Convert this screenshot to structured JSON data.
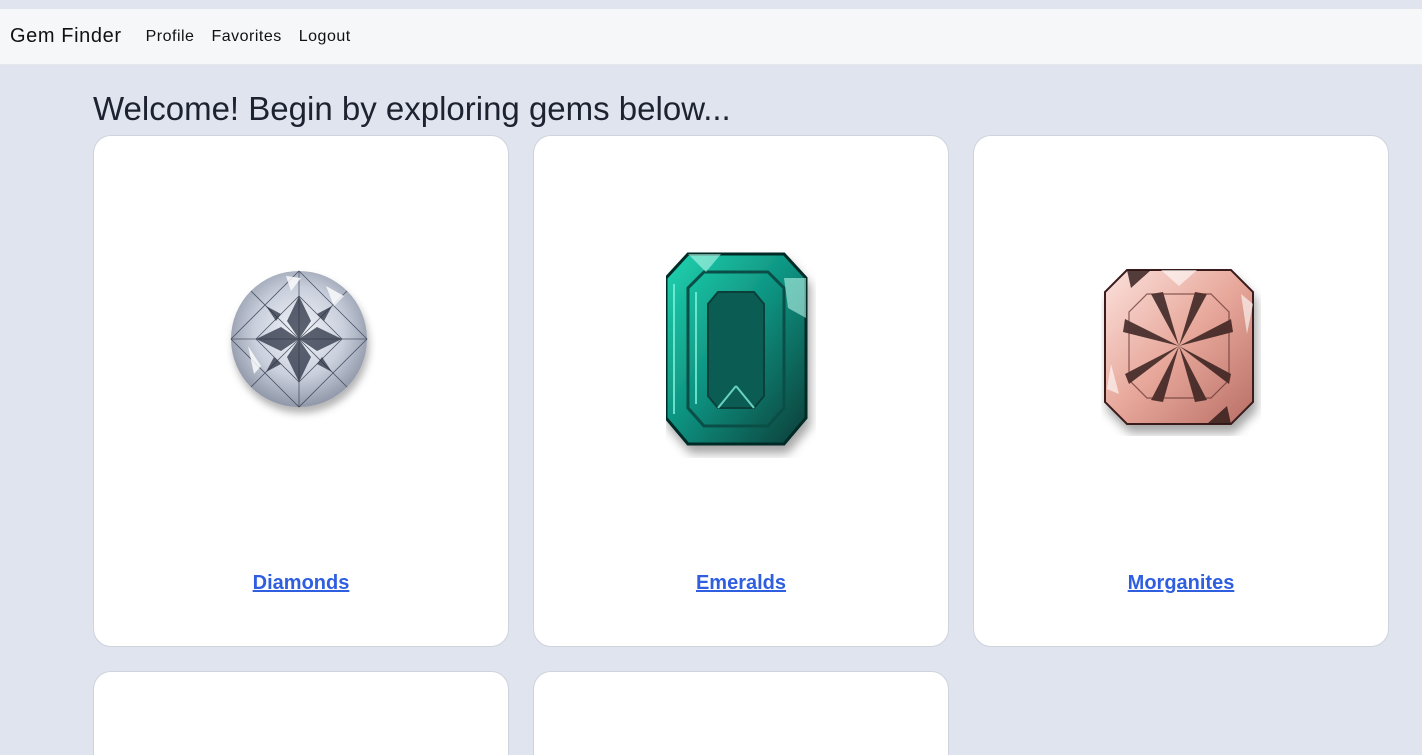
{
  "nav": {
    "brand": "Gem Finder",
    "links": [
      "Profile",
      "Favorites",
      "Logout"
    ]
  },
  "main": {
    "heading": "Welcome! Begin by exploring gems below...",
    "gems": [
      {
        "label": "Diamonds",
        "image": "diamond-image"
      },
      {
        "label": "Emeralds",
        "image": "emerald-image"
      },
      {
        "label": "Morganites",
        "image": "morganite-image"
      }
    ]
  },
  "colors": {
    "background": "#dfe4ee",
    "navbar": "#f6f7f9",
    "link": "#2f5fe0"
  }
}
